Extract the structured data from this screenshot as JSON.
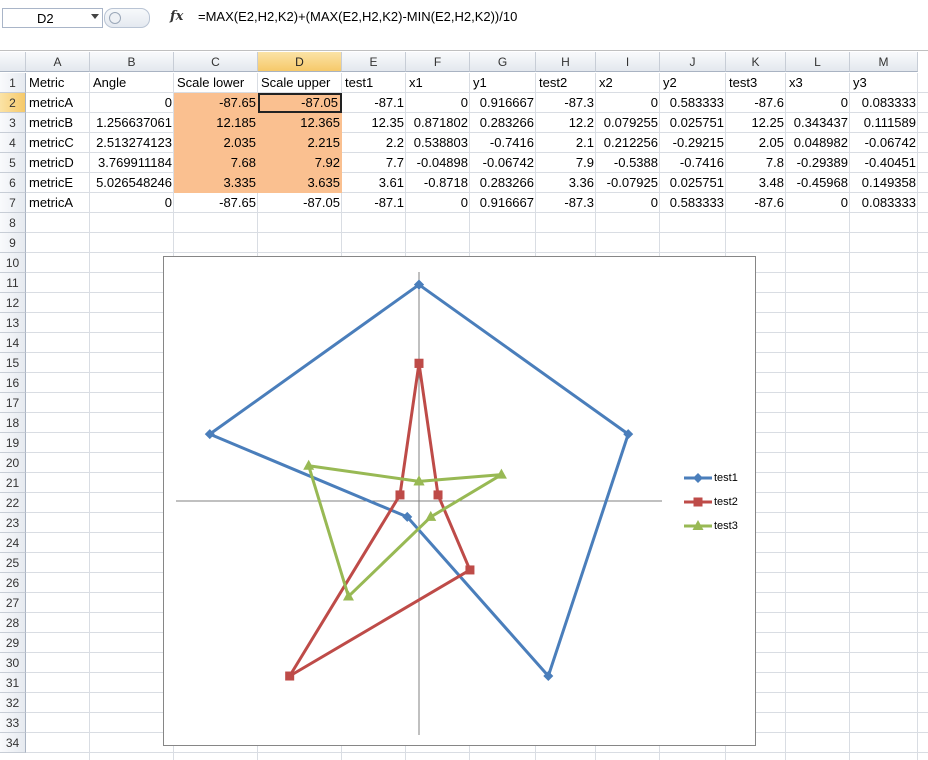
{
  "formula_bar": {
    "name_box": "D2",
    "fx_label": "fx",
    "formula": "=MAX(E2,H2,K2)+(MAX(E2,H2,K2)-MIN(E2,H2,K2))/10"
  },
  "columns": [
    "A",
    "B",
    "C",
    "D",
    "E",
    "F",
    "G",
    "H",
    "I",
    "J",
    "K",
    "L",
    "M"
  ],
  "rows": [
    "1",
    "2",
    "3",
    "4",
    "5",
    "6",
    "7",
    "8",
    "9",
    "10",
    "11",
    "12",
    "13",
    "14",
    "15",
    "16",
    "17",
    "18",
    "19",
    "20",
    "21",
    "22",
    "23",
    "24",
    "25",
    "26",
    "27",
    "28",
    "29",
    "30",
    "31",
    "32",
    "33",
    "34"
  ],
  "sheet": {
    "headers": [
      "Metric",
      "Angle",
      "Scale lower",
      "Scale upper",
      "test1",
      "x1",
      "y1",
      "test2",
      "x2",
      "y2",
      "test3",
      "x3",
      "y3"
    ],
    "data": [
      [
        "metricA",
        "0",
        "-87.65",
        "-87.05",
        "-87.1",
        "0",
        "0.916667",
        "-87.3",
        "0",
        "0.583333",
        "-87.6",
        "0",
        "0.083333"
      ],
      [
        "metricB",
        "1.256637061",
        "12.185",
        "12.365",
        "12.35",
        "0.871802",
        "0.283266",
        "12.2",
        "0.079255",
        "0.025751",
        "12.25",
        "0.343437",
        "0.111589"
      ],
      [
        "metricC",
        "2.513274123",
        "2.035",
        "2.215",
        "2.2",
        "0.538803",
        "-0.7416",
        "2.1",
        "0.212256",
        "-0.29215",
        "2.05",
        "0.048982",
        "-0.06742"
      ],
      [
        "metricD",
        "3.769911184",
        "7.68",
        "7.92",
        "7.7",
        "-0.04898",
        "-0.06742",
        "7.9",
        "-0.5388",
        "-0.7416",
        "7.8",
        "-0.29389",
        "-0.40451"
      ],
      [
        "metricE",
        "5.026548246",
        "3.335",
        "3.635",
        "3.61",
        "-0.8718",
        "0.283266",
        "3.36",
        "-0.07925",
        "0.025751",
        "3.48",
        "-0.45968",
        "0.149358"
      ],
      [
        "metricA",
        "0",
        "-87.65",
        "-87.05",
        "-87.1",
        "0",
        "0.916667",
        "-87.3",
        "0",
        "0.583333",
        "-87.6",
        "0",
        "0.083333"
      ]
    ]
  },
  "colors": {
    "highlight": "#fac090",
    "test1": "#4a7ebb",
    "test2": "#be4b48",
    "test3": "#98b954"
  },
  "chart_data": {
    "type": "scatter",
    "xlim": [
      -1,
      1
    ],
    "ylim": [
      -1,
      1
    ],
    "legend_position": "right",
    "series": [
      {
        "name": "test1",
        "marker": "diamond",
        "color": "#4a7ebb",
        "x": [
          0,
          0.871802,
          0.538803,
          -0.04898,
          -0.8718,
          0
        ],
        "y": [
          0.916667,
          0.283266,
          -0.7416,
          -0.06742,
          0.283266,
          0.916667
        ]
      },
      {
        "name": "test2",
        "marker": "square",
        "color": "#be4b48",
        "x": [
          0,
          0.079255,
          0.212256,
          -0.5388,
          -0.07925,
          0
        ],
        "y": [
          0.583333,
          0.025751,
          -0.29215,
          -0.7416,
          0.025751,
          0.583333
        ]
      },
      {
        "name": "test3",
        "marker": "triangle",
        "color": "#98b954",
        "x": [
          0,
          0.343437,
          0.048982,
          -0.29389,
          -0.45968,
          0
        ],
        "y": [
          0.083333,
          0.111589,
          -0.06742,
          -0.40451,
          0.149358,
          0.083333
        ]
      }
    ]
  }
}
